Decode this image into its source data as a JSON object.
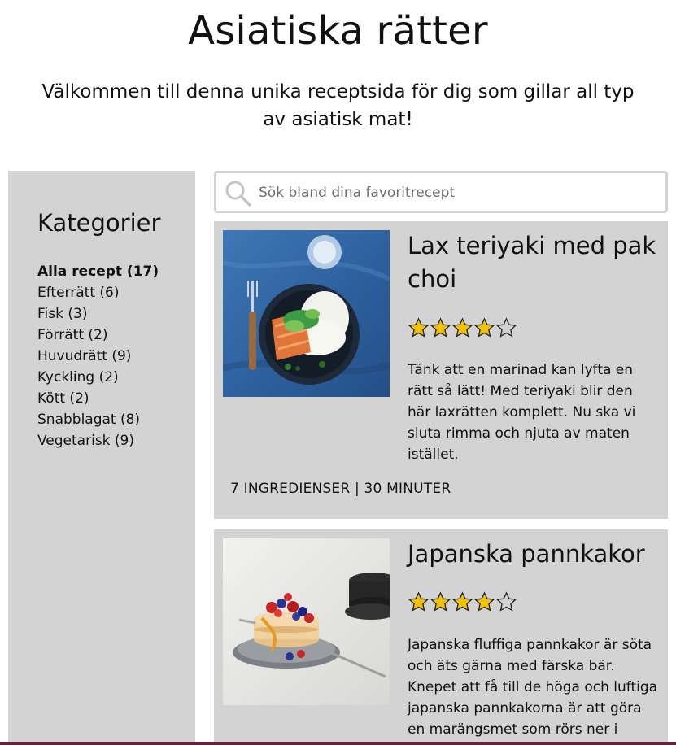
{
  "header": {
    "title": "Asiatiska rätter",
    "intro": "Välkommen till denna unika receptsida för dig som gillar all typ av asiatisk mat!"
  },
  "sidebar": {
    "heading": "Kategorier",
    "categories": [
      {
        "label": "Alla recept (17)",
        "active": true
      },
      {
        "label": "Efterrätt (6)"
      },
      {
        "label": "Fisk (3)"
      },
      {
        "label": "Förrätt (2)"
      },
      {
        "label": "Huvudrätt (9)"
      },
      {
        "label": "Kyckling (2)"
      },
      {
        "label": "Kött (2)"
      },
      {
        "label": "Snabblagat (8)"
      },
      {
        "label": "Vegetarisk (9)"
      }
    ]
  },
  "search": {
    "placeholder": "Sök bland dina favoritrecept",
    "value": "",
    "icon": "search-icon"
  },
  "recipes": [
    {
      "title": "Lax teriyaki med pak choi",
      "rating": 4,
      "rating_max": 5,
      "description": "Tänk att en marinad kan lyfta en rätt så lätt! Med teriyaki blir den här laxrätten komplett. Nu ska vi sluta rimma och njuta av maten istället.",
      "meta": "7 INGREDIENSER | 30 MINUTER"
    },
    {
      "title": "Japanska pannkakor",
      "rating": 4,
      "rating_max": 5,
      "description": "Japanska fluffiga pannkakor är söta och äts gärna med färska bär. Knepet att få till de höga och luftiga japanska pannkakorna är att göra en marängsmet som rörs ner i"
    }
  ],
  "colors": {
    "panel": "#d3d3d3",
    "star_fill": "#f2c200",
    "star_empty": "#d3d3d3",
    "accent_line": "#6b1f3a"
  }
}
